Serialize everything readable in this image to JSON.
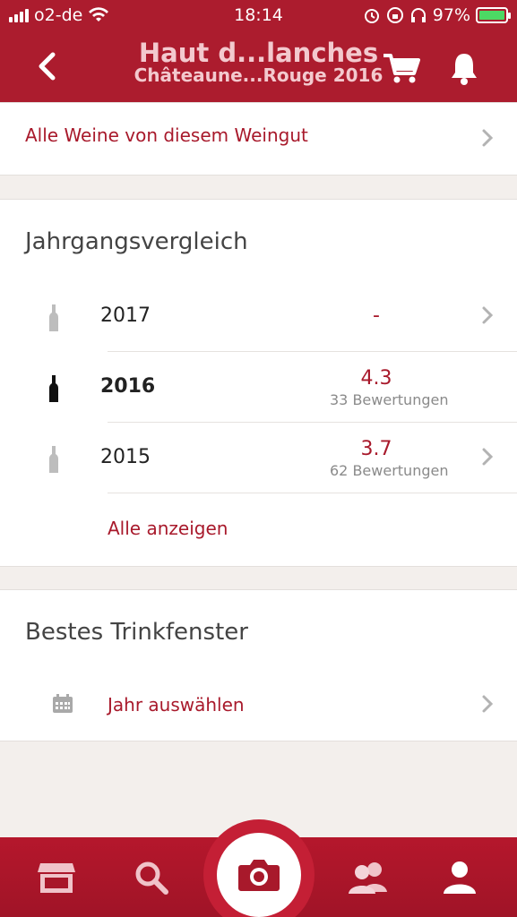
{
  "status_bar": {
    "carrier": "o2-de",
    "time": "18:14",
    "battery_percent": "97%",
    "battery_level": 0.97
  },
  "header": {
    "title": "Haut d...lanches",
    "subtitle": "Châteaune...Rouge 2016",
    "icons": [
      "back-icon",
      "cart-icon",
      "bell-icon"
    ]
  },
  "winery_link": {
    "label": "Alle Weine von diesem Weingut"
  },
  "vintage_comparison": {
    "title": "Jahrgangsvergleich",
    "rows": [
      {
        "year": "2017",
        "score": "-",
        "ratings": ""
      },
      {
        "year": "2016",
        "score": "4.3",
        "ratings": "33 Bewertungen"
      },
      {
        "year": "2015",
        "score": "3.7",
        "ratings": "62 Bewertungen"
      }
    ],
    "show_all": "Alle anzeigen"
  },
  "drinking_window": {
    "title": "Bestes Trinkfenster",
    "select_year": "Jahr auswählen"
  },
  "tabbar": {
    "items": [
      "store-icon",
      "search-icon",
      "camera-icon",
      "friends-icon",
      "profile-icon"
    ]
  },
  "colors": {
    "brand": "#ac1c2e",
    "accent_text": "#a8192b",
    "background": "#f3efec"
  }
}
